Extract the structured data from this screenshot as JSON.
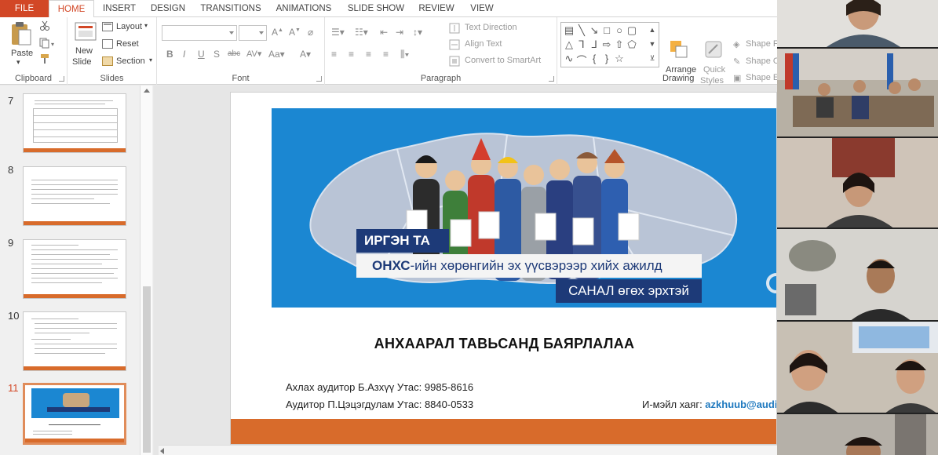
{
  "tabs": [
    "FILE",
    "HOME",
    "INSERT",
    "DESIGN",
    "TRANSITIONS",
    "ANIMATIONS",
    "SLIDE SHOW",
    "REVIEW",
    "VIEW"
  ],
  "ribbon": {
    "clipboard": {
      "paste": "Paste",
      "label": "Clipboard"
    },
    "slides": {
      "new_slide_line1": "New",
      "new_slide_line2": "Slide",
      "layout": "Layout",
      "reset": "Reset",
      "section": "Section",
      "label": "Slides"
    },
    "font": {
      "label": "Font"
    },
    "paragraph": {
      "text_direction": "Text Direction",
      "align_text": "Align Text",
      "convert": "Convert to SmartArt",
      "label": "Paragraph"
    },
    "drawing": {
      "arrange": "Arrange",
      "quick_styles_line1": "Quick",
      "quick_styles_line2": "Styles",
      "shape_fill": "Shape Fi",
      "shape_outline": "Shape O",
      "shape_effects": "Shape Ef",
      "label": "Drawing"
    }
  },
  "thumbnails": [
    {
      "num": "7"
    },
    {
      "num": "8"
    },
    {
      "num": "9"
    },
    {
      "num": "10"
    },
    {
      "num": "11"
    }
  ],
  "slide": {
    "banner_line1": "ИРГЭН ТА",
    "banner_line2_bold": "ОНХС",
    "banner_line2_rest": "-ийн хөрөнгийн эх үүсвэрээр хийх ажилд",
    "banner_line3": "САНАЛ өгөх эрхтэй",
    "thanks": "АНХААРАЛ ТАВЬСАНД БАЯРЛАЛАА",
    "contact1": "Ахлах аудитор Б.Азхүү   Утас: 9985-8616",
    "contact2": "Аудитор П.Цэцэгдулам   Утас: 8840-0533",
    "email_label": "И-мэйл хаяг: ",
    "email_value": "azkhuub@audi"
  },
  "colors": {
    "accent": "#d24726",
    "slide_bar": "#d86b2b",
    "banner_blue": "#1b87d2",
    "banner_navy": "#1d3a78",
    "email_blue": "#1f79bf"
  }
}
